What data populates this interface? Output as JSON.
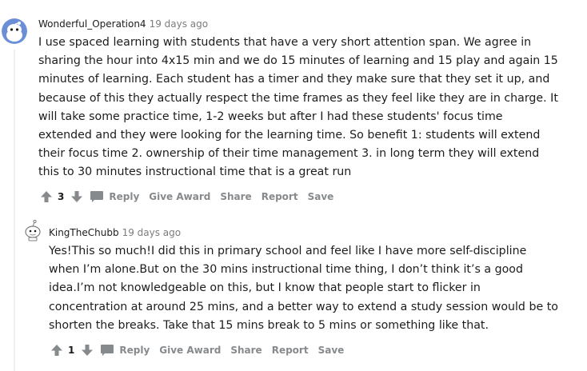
{
  "comments": [
    {
      "author": "Wonderful_Operation4",
      "time": "19 days ago",
      "body": "I use spaced learning with students that have a very short attention span. We agree in sharing the hour into 4x15 min and we do 15 minutes of learning and 15 play and again 15 minutes of learning. Each student has a timer and they make sure that they set it up, and because of this they actually respect the time frames as they feel like they are in charge. It will take some practice time, 1-2 weeks but after I had these students' focus time extended and they were looking for the learning time. So benefit 1: students will extend their focus time 2. ownership of their time management 3. in long term they will extend this to 30 minutes instructional time that is a great run",
      "score": "3",
      "actions": {
        "reply": "Reply",
        "give_award": "Give Award",
        "share": "Share",
        "report": "Report",
        "save": "Save"
      }
    },
    {
      "author": "KingTheChubb",
      "time": "19 days ago",
      "body": "Yes!This so much!I did this in primary school and feel like I have more self-discipline when I’m alone.But on the 30 mins instructional time thing, I don’t think it’s a good idea.I’m not knowledgeable on this, but I know that people start to flicker in concentration at around 25 mins, and a better way to extend a study session would be to shorten the breaks. Take that 15 mins break to 5 mins or something like that.",
      "score": "1",
      "actions": {
        "reply": "Reply",
        "give_award": "Give Award",
        "share": "Share",
        "report": "Report",
        "save": "Save"
      }
    }
  ],
  "colors": {
    "meta": "#7c7c7c",
    "action": "#878a8c",
    "text": "#1c1c1c",
    "thread_line": "#edeff1"
  }
}
